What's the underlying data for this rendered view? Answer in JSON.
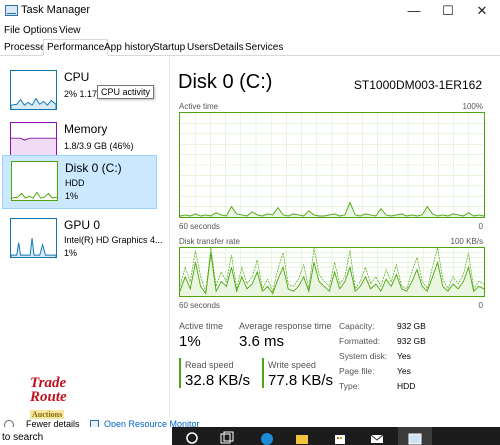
{
  "window": {
    "title": "Task Manager",
    "minimize": "—",
    "maximize": "☐",
    "close": "✕"
  },
  "menu": [
    "File",
    "Options",
    "View"
  ],
  "tabs": [
    "Processes",
    "Performance",
    "App history",
    "Startup",
    "Users",
    "Details",
    "Services"
  ],
  "active_tab": "Performance",
  "sidebar": [
    {
      "name": "CPU",
      "sub": "2%  1.17",
      "icon": "cpu-graph-icon"
    },
    {
      "name": "Memory",
      "sub": "1.8/3.9 GB (46%)",
      "icon": "memory-graph-icon"
    },
    {
      "name": "Disk 0 (C:)",
      "sub": "HDD",
      "sub2": "1%",
      "icon": "disk-graph-icon",
      "selected": true
    },
    {
      "name": "GPU 0",
      "sub": "Intel(R) HD Graphics 4...",
      "sub2": "1%",
      "icon": "gpu-graph-icon"
    }
  ],
  "tooltip": "CPU activity",
  "main": {
    "title": "Disk 0 (C:)",
    "model": "ST1000DM003-1ER162",
    "graph1": {
      "label": "Active time",
      "max": "100%",
      "xlabel": "60 seconds",
      "min": "0"
    },
    "graph2": {
      "label": "Disk transfer rate",
      "max": "100 KB/s",
      "xlabel": "60 seconds",
      "min": "0"
    }
  },
  "stats": {
    "active_time_label": "Active time",
    "active_time_value": "1%",
    "avg_response_label": "Average response time",
    "avg_response_value": "3.6 ms",
    "read_speed_label": "Read speed",
    "read_speed_value": "32.8 KB/s",
    "write_speed_label": "Write speed",
    "write_speed_value": "77.8 KB/s"
  },
  "info": [
    {
      "label": "Capacity:",
      "value": "932 GB"
    },
    {
      "label": "Formatted:",
      "value": "932 GB"
    },
    {
      "label": "System disk:",
      "value": "Yes"
    },
    {
      "label": "Page file:",
      "value": "Yes"
    },
    {
      "label": "Type:",
      "value": "HDD"
    }
  ],
  "watermark": {
    "line1": "Trade",
    "line2": "Route",
    "line3": "Auctions"
  },
  "footer": {
    "fewer_details": "Fewer details",
    "open_monitor": "Open Resource Monitor"
  },
  "taskbar": {
    "search_text": "to search"
  },
  "colors": {
    "disk": "#4da60c",
    "cpu": "#1175b2",
    "memory": "#8b12ae",
    "selected_bg": "#cce8ff"
  },
  "chart_data": [
    {
      "type": "line",
      "title": "Active time",
      "xlabel": "60 seconds",
      "ylim": [
        0,
        100
      ],
      "y_unit": "%",
      "series": [
        {
          "values": [
            1,
            2,
            1,
            3,
            1,
            2,
            1,
            4,
            2,
            1,
            10,
            3,
            2,
            1,
            5,
            2,
            1,
            3,
            2,
            9,
            2,
            1,
            3,
            2,
            1,
            6,
            2,
            1,
            1,
            2,
            3,
            1,
            2,
            14,
            2,
            1,
            3,
            2,
            1,
            8,
            2,
            1,
            2,
            3,
            1,
            2,
            1,
            2,
            10,
            3,
            1,
            2,
            1,
            3,
            2,
            1,
            4,
            1,
            2,
            1
          ]
        }
      ]
    },
    {
      "type": "line",
      "title": "Disk transfer rate",
      "xlabel": "60 seconds",
      "ylim": [
        0,
        100
      ],
      "y_unit": "KB/s",
      "series": [
        {
          "name": "Read speed",
          "values": [
            10,
            40,
            15,
            70,
            20,
            5,
            90,
            10,
            30,
            20,
            60,
            10,
            40,
            15,
            25,
            50,
            10,
            20,
            5,
            35,
            60,
            15,
            10,
            20,
            40,
            10,
            70,
            30,
            20,
            10,
            50,
            15,
            30,
            60,
            10,
            20,
            40,
            15,
            25,
            10,
            35,
            20,
            45,
            15,
            10,
            30,
            55,
            20,
            10,
            40,
            70,
            20,
            10,
            25,
            15,
            30,
            60,
            10,
            20,
            15
          ]
        },
        {
          "name": "Write speed",
          "values": [
            20,
            60,
            30,
            95,
            40,
            10,
            100,
            20,
            50,
            30,
            85,
            15,
            60,
            25,
            40,
            75,
            15,
            35,
            10,
            55,
            90,
            25,
            20,
            35,
            65,
            15,
            100,
            45,
            30,
            20,
            70,
            25,
            40,
            95,
            15,
            30,
            60,
            25,
            40,
            20,
            55,
            30,
            65,
            20,
            15,
            50,
            80,
            30,
            15,
            60,
            100,
            35,
            15,
            40,
            25,
            45,
            90,
            15,
            30,
            25
          ]
        }
      ]
    }
  ]
}
